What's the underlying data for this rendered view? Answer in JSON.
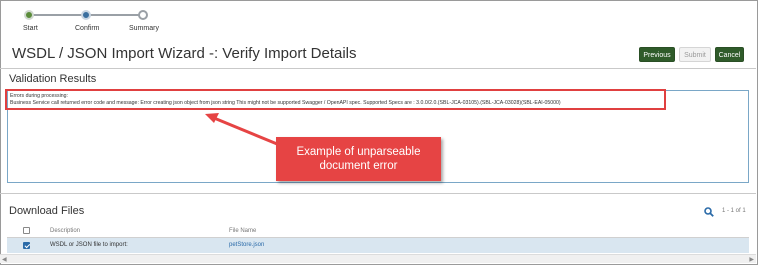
{
  "stepper": {
    "steps": [
      {
        "label": "Start",
        "state": "done"
      },
      {
        "label": "Confirm",
        "state": "current"
      },
      {
        "label": "Summary",
        "state": "todo"
      }
    ]
  },
  "header": {
    "title": "WSDL / JSON Import Wizard -: Verify Import Details",
    "buttons": {
      "previous": "Previous",
      "submit": "Submit",
      "cancel": "Cancel"
    }
  },
  "validation": {
    "title": "Validation Results",
    "lines": [
      "Errors during processing:",
      "Business Service call returned error code  and message: Error creating json object from json string  This might not be supported Swagger / OpenAPI spec. Supported Specs are : 3.0.0/2.0.(SBL-JCA-03105).(SBL-JCA-03028)(SBL-EAI-05000)"
    ]
  },
  "callout": {
    "line1": "Example of unparseable",
    "line2": "document error"
  },
  "download": {
    "title": "Download Files",
    "pager": "1 - 1 of 1",
    "columns": {
      "description": "Description",
      "file_name": "File Name"
    },
    "rows": [
      {
        "description": "WSDL or JSON file to import:",
        "file_name": "petStore.json",
        "checked": true
      }
    ]
  },
  "colors": {
    "primary_button": "#2f5b2a",
    "callout": "#e64444",
    "highlight": "#e04040",
    "selected_row": "#d9e6f0",
    "link": "#2a6aa8"
  }
}
